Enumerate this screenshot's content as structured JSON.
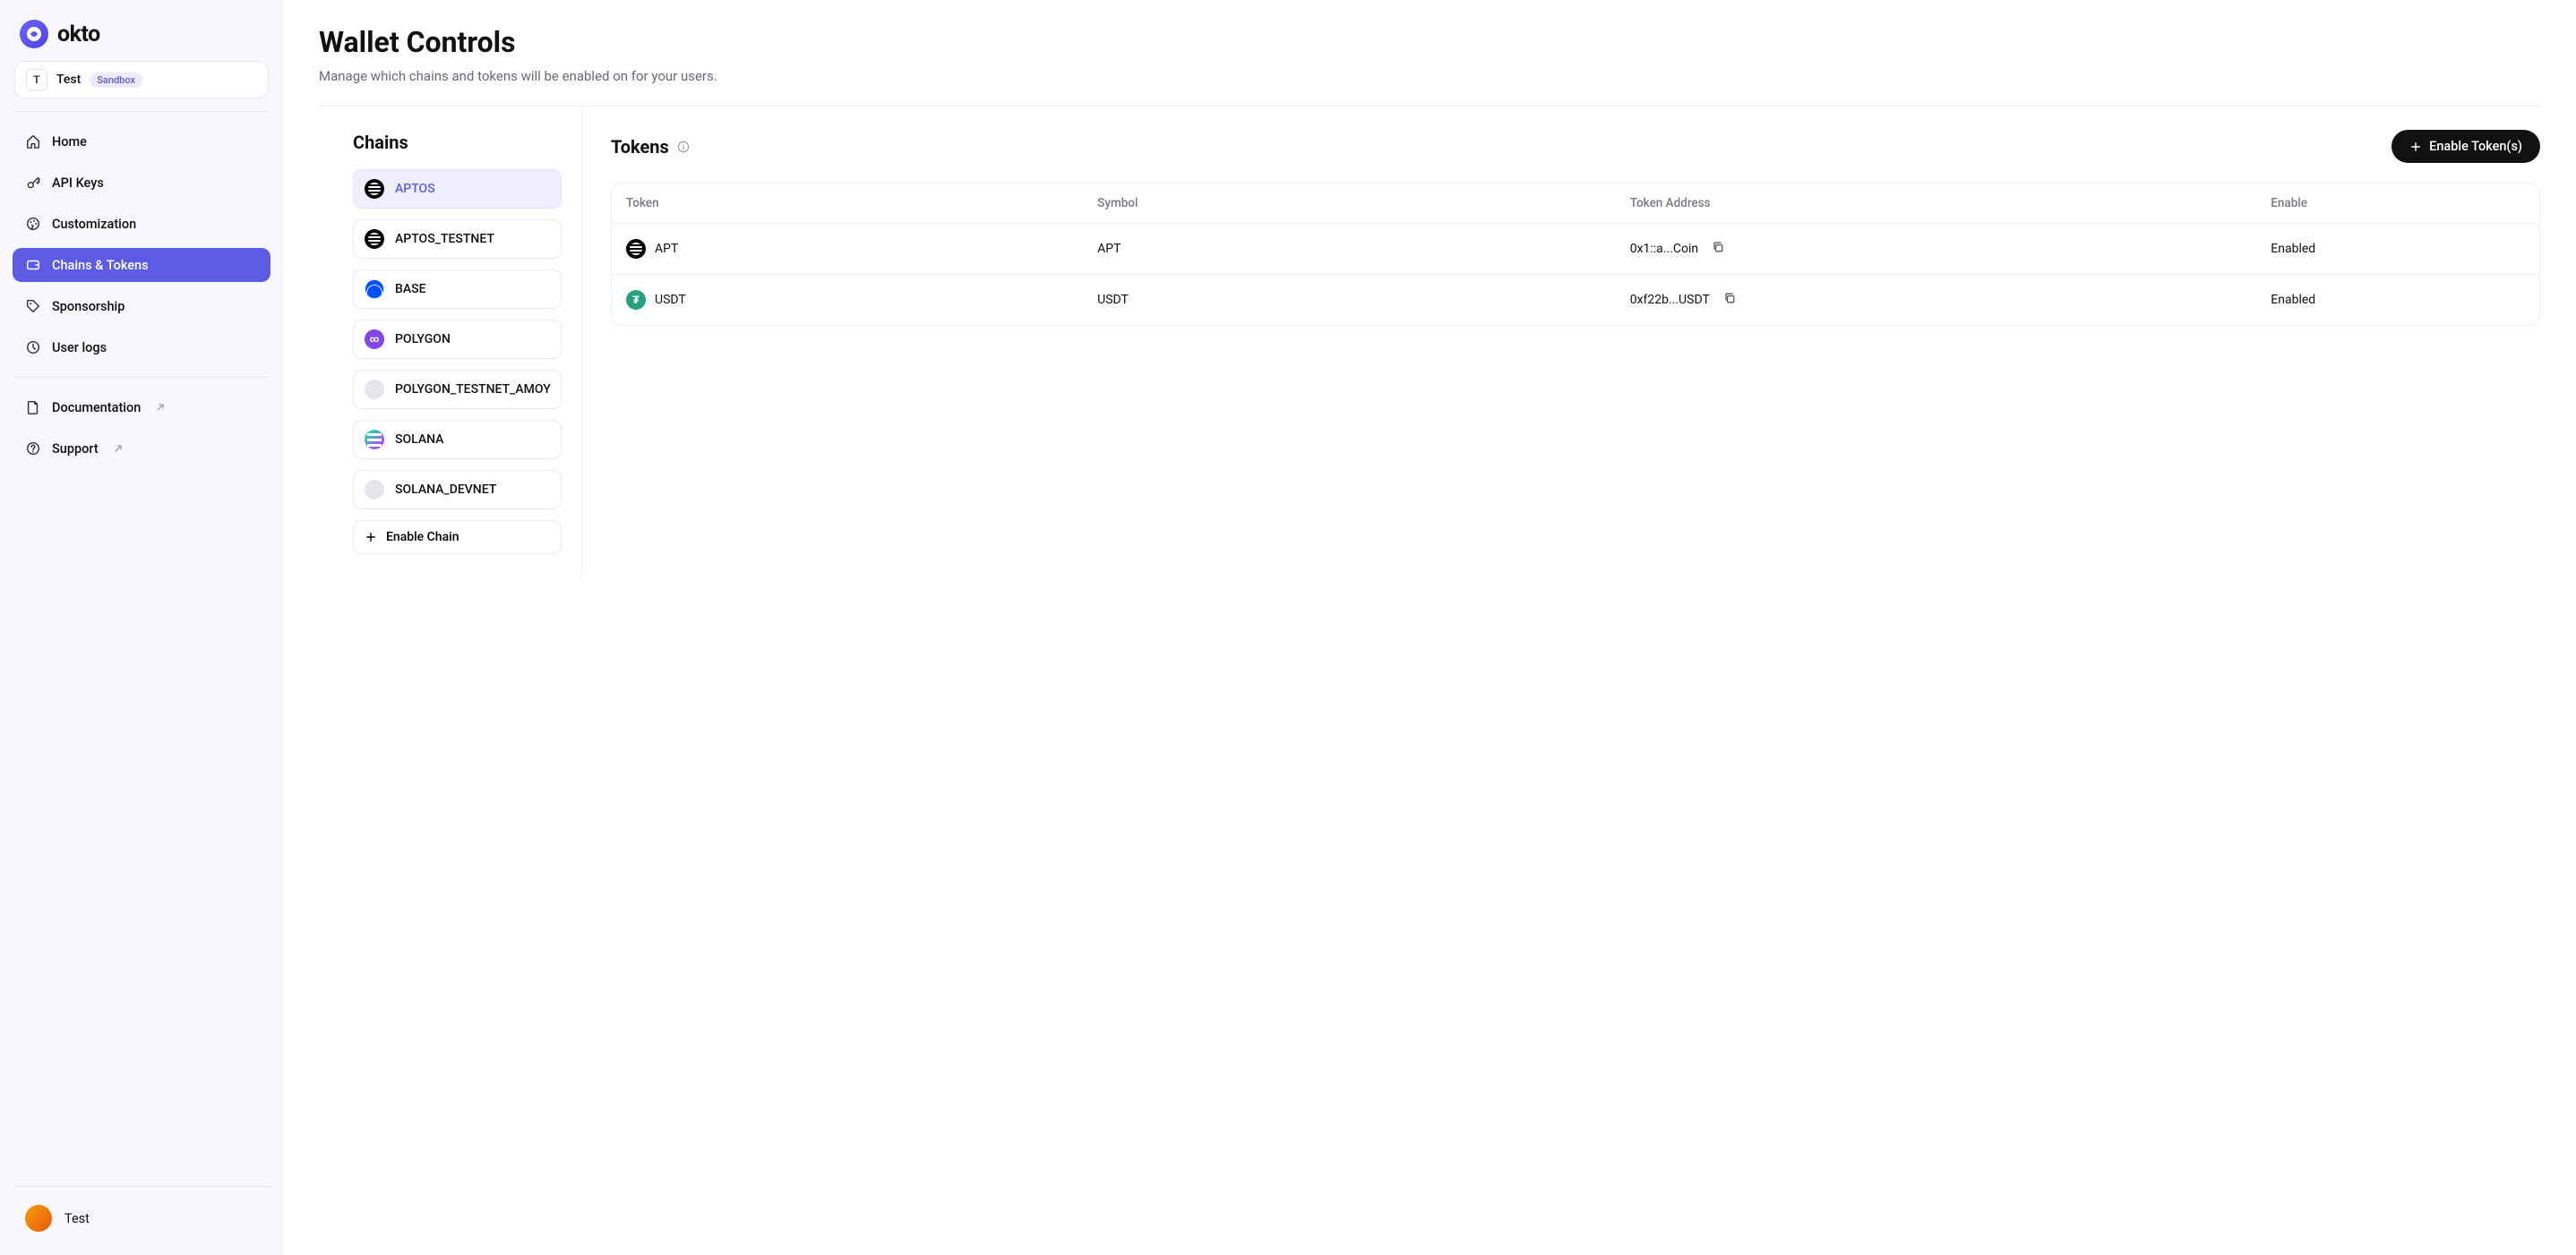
{
  "brand": {
    "name": "okto"
  },
  "workspace": {
    "initial": "T",
    "name": "Test",
    "badge": "Sandbox"
  },
  "nav": {
    "items": [
      {
        "label": "Home",
        "icon": "home"
      },
      {
        "label": "API Keys",
        "icon": "key"
      },
      {
        "label": "Customization",
        "icon": "palette"
      },
      {
        "label": "Chains & Tokens",
        "icon": "wallet",
        "active": true
      },
      {
        "label": "Sponsorship",
        "icon": "tag"
      },
      {
        "label": "User logs",
        "icon": "clock"
      }
    ],
    "secondary": [
      {
        "label": "Documentation",
        "icon": "file",
        "external": true
      },
      {
        "label": "Support",
        "icon": "help",
        "external": true
      }
    ]
  },
  "user": {
    "name": "Test"
  },
  "page": {
    "title": "Wallet Controls",
    "subtitle": "Manage which chains and tokens will be enabled on for your users."
  },
  "chains": {
    "title": "Chains",
    "enable_label": "Enable Chain",
    "items": [
      {
        "label": "APTOS",
        "icon": "aptos",
        "selected": true
      },
      {
        "label": "APTOS_TESTNET",
        "icon": "aptos"
      },
      {
        "label": "BASE",
        "icon": "base"
      },
      {
        "label": "POLYGON",
        "icon": "polygon"
      },
      {
        "label": "POLYGON_TESTNET_AMOY",
        "icon": "gray"
      },
      {
        "label": "SOLANA",
        "icon": "solana"
      },
      {
        "label": "SOLANA_DEVNET",
        "icon": "gray"
      }
    ]
  },
  "tokens": {
    "title": "Tokens",
    "enable_label": "Enable Token(s)",
    "columns": {
      "token": "Token",
      "symbol": "Symbol",
      "address": "Token Address",
      "enable": "Enable"
    },
    "rows": [
      {
        "icon": "apt",
        "name": "APT",
        "symbol": "APT",
        "address": "0x1::a...Coin",
        "status": "Enabled"
      },
      {
        "icon": "usdt",
        "name": "USDT",
        "symbol": "USDT",
        "address": "0xf22b...USDT",
        "status": "Enabled"
      }
    ]
  }
}
